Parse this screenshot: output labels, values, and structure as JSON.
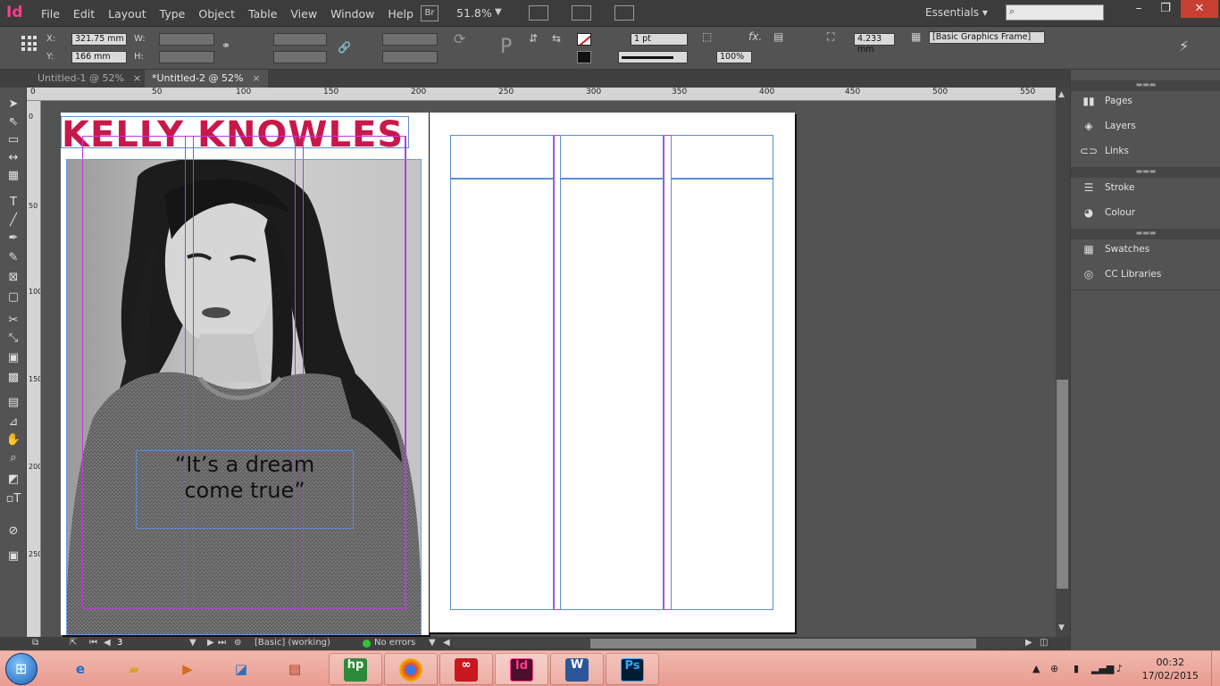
{
  "app": {
    "logo": "Id",
    "menus": [
      "File",
      "Edit",
      "Layout",
      "Type",
      "Object",
      "Table",
      "View",
      "Window",
      "Help"
    ],
    "bridge_label": "Br",
    "zoom": "51.8%",
    "workspace": "Essentials",
    "search_placeholder": ""
  },
  "control": {
    "x_label": "X:",
    "x_value": "321.75 mm",
    "y_label": "Y:",
    "y_value": "166 mm",
    "w_label": "W:",
    "h_label": "H:",
    "stroke_weight": "1 pt",
    "fx_label": "fx.",
    "opacity": "100%",
    "offset": "4.233 mm",
    "object_style": "[Basic Graphics Frame]"
  },
  "tabs": [
    {
      "label": "Untitled-1 @ 52%",
      "close": "×"
    },
    {
      "label": "*Untitled-2 @ 52%",
      "close": "×"
    }
  ],
  "ruler": {
    "h_ticks": [
      "0",
      "50",
      "100",
      "150",
      "200",
      "250",
      "300",
      "350",
      "400",
      "450",
      "500",
      "550"
    ],
    "v_ticks": [
      "0",
      "50",
      "100",
      "150",
      "200",
      "250"
    ]
  },
  "document": {
    "headline": "KELLY KNOWLES",
    "quote_line1": "“It’s a dream",
    "quote_line2": "come true”"
  },
  "status": {
    "page_number": "3",
    "preflight_profile": "[Basic] (working)",
    "errors": "No errors"
  },
  "panels": [
    {
      "label": "Pages",
      "icon": "pages-icon"
    },
    {
      "label": "Layers",
      "icon": "layers-icon"
    },
    {
      "label": "Links",
      "icon": "links-icon"
    },
    {
      "label": "Stroke",
      "icon": "stroke-icon"
    },
    {
      "label": "Colour",
      "icon": "colour-icon"
    },
    {
      "label": "Swatches",
      "icon": "swatches-icon"
    },
    {
      "label": "CC Libraries",
      "icon": "cc-libraries-icon"
    }
  ],
  "taskbar": {
    "time": "00:32",
    "date": "17/02/2015",
    "apps": [
      "Id",
      "W",
      "Ps"
    ]
  },
  "colors": {
    "headline": "#c8184a",
    "guide_magenta": "#c23bd9",
    "guide_violet": "#9b47e0",
    "frame_blue": "#5b8ed6",
    "taskbar": "#eca79c"
  }
}
